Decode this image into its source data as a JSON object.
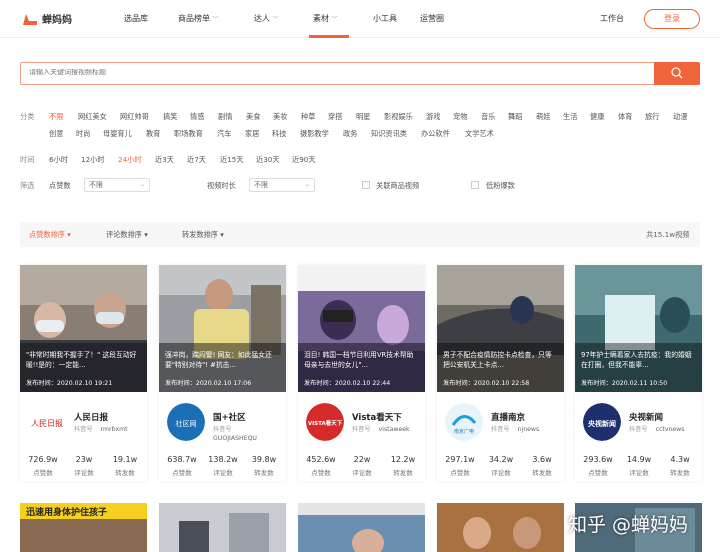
{
  "brand": {
    "name": "蝉妈妈",
    "accent": "#f0643c"
  },
  "nav": [
    "选品库",
    "商品榜单",
    "达人",
    "素材",
    "小工具",
    "运营圈"
  ],
  "nav_active": "素材",
  "header": {
    "workbench": "工作台",
    "login": "登录"
  },
  "search": {
    "placeholder": "请输入关键词搜视频标题"
  },
  "filters": {
    "category_label": "分类",
    "categories_row1": [
      "不限",
      "网红美女",
      "网红帅哥",
      "搞笑",
      "情感",
      "剧情",
      "美食",
      "美妆",
      "种草",
      "穿搭",
      "明星",
      "影视娱乐",
      "游戏",
      "宠物",
      "音乐",
      "舞蹈",
      "萌娃",
      "生活",
      "健康",
      "体育",
      "旅行",
      "动漫"
    ],
    "categories_row2": [
      "创意",
      "时尚",
      "母婴育儿",
      "教育",
      "职场教育",
      "汽车",
      "家居",
      "科技",
      "摄影教学",
      "政务",
      "知识资讯类",
      "办公软件",
      "文学艺术"
    ],
    "time_label": "时间",
    "times": [
      "6小时",
      "12小时",
      "24小时",
      "近3天",
      "近7天",
      "近15天",
      "近30天",
      "近90天"
    ],
    "time_active": "24小时",
    "screen_label": "筛选",
    "likes_label": "点赞数",
    "likes_value": "不限",
    "duration_label": "视频时长",
    "duration_value": "不限",
    "related_goods": "关联商品视频",
    "low_fans": "低粉爆款"
  },
  "sort": {
    "likes": "点赞数排序 ▾",
    "comments": "评论数排序 ▾",
    "shares": "转发数排序 ▾",
    "total": "共15.1w视频"
  },
  "cards": [
    {
      "caption": "\"非常时期我不握手了！\" 这段互动好暖!!是的：一定能...",
      "pub": "发布时间：2020.02.10 19:21",
      "name": "人民日报",
      "acct_label": "抖音号",
      "acct": "rmrbxmt",
      "stats": [
        "726.9w",
        "23w",
        "19.1w"
      ]
    },
    {
      "caption": "强冲岗，踹闷警! 网友：如此猛女还要\"特别对待\"! #抗击...",
      "pub": "发布时间：2020.02.10 17:06",
      "name": "国+社区",
      "acct_label": "抖音号",
      "acct": "GUOJIASHEQU",
      "stats": [
        "638.7w",
        "138.2w",
        "39.8w"
      ]
    },
    {
      "caption": "泪目! 韩国一档节目利用VR技术帮助母亲与去世的女儿\"...",
      "pub": "发布时间：2020.02.10 22:44",
      "name": "Vista看天下",
      "acct_label": "抖音号",
      "acct": "vistaweek",
      "stats": [
        "452.6w",
        "22w",
        "12.2w"
      ]
    },
    {
      "caption": "男子不配合疫情防控卡点检查，只等把公安机关上卡点...",
      "pub": "发布时间：2020.02.10 22:58",
      "name": "直播南京",
      "acct_label": "抖音号",
      "acct": "njnews",
      "stats": [
        "297.1w",
        "34.2w",
        "3.6w"
      ]
    },
    {
      "caption": "97年护士瞒着家人去抗疫：我的婚姻在打圈，但我不能辜...",
      "pub": "发布时间：2020.02.11 10:50",
      "name": "央视新闻",
      "acct_label": "抖音号",
      "acct": "cctvnews",
      "stats": [
        "293.6w",
        "14.9w",
        "4.3w"
      ]
    }
  ],
  "stat_labels": [
    "点赞数",
    "评论数",
    "转发数"
  ],
  "logo_texts": {
    "c1": "人民日报",
    "c2": "社区网",
    "c3": "VISTA看天下",
    "c4": "南京广电",
    "c5": "央视新闻"
  },
  "row2_banner": "迅速用身体护住孩子",
  "watermark": "知乎 @蝉妈妈"
}
